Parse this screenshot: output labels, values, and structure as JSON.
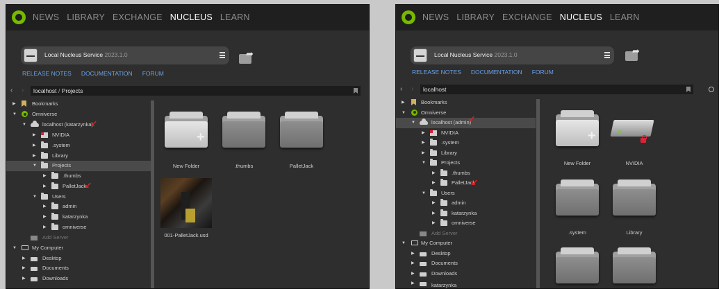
{
  "nav_items": [
    "NEWS",
    "LIBRARY",
    "EXCHANGE",
    "NUCLEUS",
    "LEARN"
  ],
  "active_nav": "NUCLEUS",
  "service": {
    "name": "Local Nucleus Service",
    "version": "2023.1.0"
  },
  "links": [
    "RELEASE NOTES",
    "DOCUMENTATION",
    "FORUM"
  ],
  "left": {
    "path": [
      "localhost",
      "/",
      "Projects"
    ],
    "tree": {
      "bookmarks": "Bookmarks",
      "omniverse": "Omniverse",
      "host": "localhost (katarzynka)",
      "nvidia": "NVIDIA",
      "system": ".system",
      "library": "Library",
      "projects": "Projects",
      "thumbs": ".thumbs",
      "palletjack": "PalletJack",
      "users": "Users",
      "admin": "admin",
      "katarzynka": "katarzynka",
      "omniverse_user": "omniverse",
      "add_server": "Add Server",
      "my_computer": "My Computer",
      "desktop": "Desktop",
      "documents": "Documents",
      "downloads": "Downloads"
    },
    "tiles": {
      "new_folder": "New Folder",
      "thumbs": ".thumbs",
      "palletjack": "PalletJack",
      "usd_file": "001-PalletJack.usd"
    }
  },
  "right": {
    "path": "localhost",
    "tree": {
      "bookmarks": "Bookmarks",
      "omniverse": "Omniverse",
      "host": "localhost (admin)",
      "nvidia": "NVIDIA",
      "system": ".system",
      "library": "Library",
      "projects": "Projects",
      "thumbs": ".thumbs",
      "palletjack": "PalletJack",
      "users": "Users",
      "admin": "admin",
      "katarzynka": "katarzynka",
      "omniverse_user": "omniverse",
      "add_server": "Add Server",
      "my_computer": "My Computer",
      "desktop": "Desktop",
      "documents": "Documents",
      "downloads": "Downloads",
      "partial": "katarzynka"
    },
    "tiles": {
      "new_folder": "New Folder",
      "nvidia": "NVIDIA",
      "system": ".system",
      "library": "Library"
    }
  },
  "icons": [
    "omniverse-logo-icon",
    "server-drive-icon",
    "menu-icon",
    "share-folder-icon",
    "chevron-left-icon",
    "chevron-right-icon",
    "bookmark-icon",
    "search-icon",
    "folder-icon",
    "cloud-icon",
    "monitor-icon",
    "lock-icon",
    "red-arrow-annotation"
  ],
  "colors": {
    "accent_green": "#76b900",
    "link_blue": "#6ba0e6",
    "annotation_red": "#e02020",
    "panel_bg": "#2e2e2e",
    "nav_bg": "#1f1f1f"
  }
}
